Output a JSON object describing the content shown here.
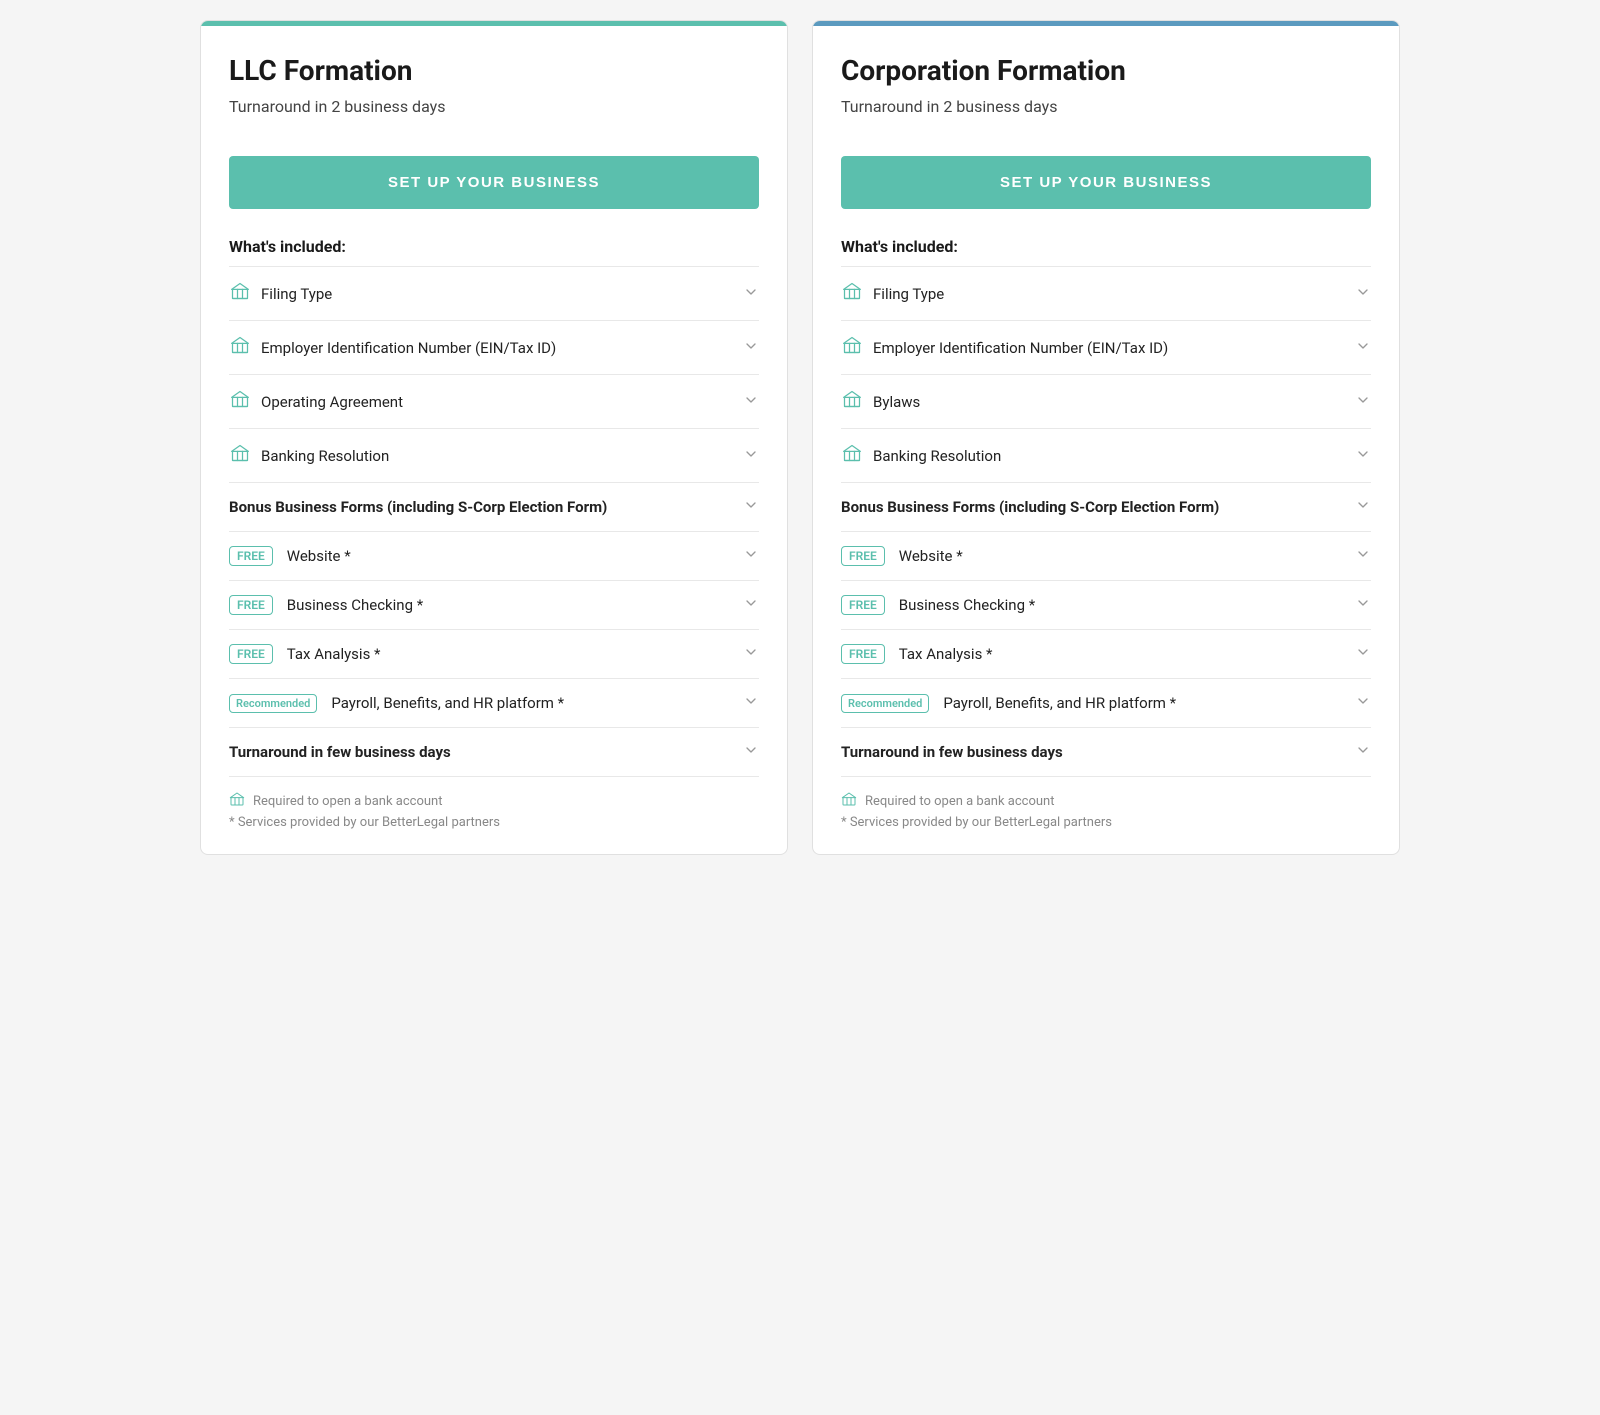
{
  "cards": [
    {
      "id": "llc",
      "colorClass": "card-llc",
      "title": "LLC Formation",
      "subtitle": "Turnaround in 2 business days",
      "button_label": "SET UP YOUR BUSINESS",
      "whats_included": "What's included:",
      "items": [
        {
          "type": "icon",
          "icon": "bank",
          "label": "Filing Type",
          "bold": false
        },
        {
          "type": "icon",
          "icon": "bank",
          "label": "Employer Identification Number (EIN/Tax ID)",
          "bold": false
        },
        {
          "type": "icon",
          "icon": "bank",
          "label": "Operating Agreement",
          "bold": false
        },
        {
          "type": "icon",
          "icon": "bank",
          "label": "Banking Resolution",
          "bold": false
        },
        {
          "type": "plain",
          "label": "Bonus Business Forms (including S-Corp Election Form)",
          "bold": true
        },
        {
          "type": "badge",
          "badge": "FREE",
          "label": "Website *",
          "bold": false
        },
        {
          "type": "badge",
          "badge": "FREE",
          "label": "Business Checking *",
          "bold": false
        },
        {
          "type": "badge",
          "badge": "FREE",
          "label": "Tax Analysis *",
          "bold": false
        },
        {
          "type": "badge",
          "badge": "Recommended",
          "badge_class": "badge-recommended",
          "label": "Payroll, Benefits, and HR platform *",
          "bold": false
        },
        {
          "type": "plain",
          "label": "Turnaround in few business days",
          "bold": true
        }
      ],
      "footer_icon_note": "Required to open a bank account",
      "footer_star_note": "* Services provided by our BetterLegal partners"
    },
    {
      "id": "corp",
      "colorClass": "card-corp",
      "title": "Corporation Formation",
      "subtitle": "Turnaround in 2 business days",
      "button_label": "SET UP YOUR BUSINESS",
      "whats_included": "What's included:",
      "items": [
        {
          "type": "icon",
          "icon": "bank",
          "label": "Filing Type",
          "bold": false
        },
        {
          "type": "icon",
          "icon": "bank",
          "label": "Employer Identification Number (EIN/Tax ID)",
          "bold": false
        },
        {
          "type": "icon",
          "icon": "bank",
          "label": "Bylaws",
          "bold": false
        },
        {
          "type": "icon",
          "icon": "bank",
          "label": "Banking Resolution",
          "bold": false
        },
        {
          "type": "plain",
          "label": "Bonus Business Forms (including S-Corp Election Form)",
          "bold": true
        },
        {
          "type": "badge",
          "badge": "FREE",
          "label": "Website *",
          "bold": false
        },
        {
          "type": "badge",
          "badge": "FREE",
          "label": "Business Checking *",
          "bold": false
        },
        {
          "type": "badge",
          "badge": "FREE",
          "label": "Tax Analysis *",
          "bold": false
        },
        {
          "type": "badge",
          "badge": "Recommended",
          "badge_class": "badge-recommended",
          "label": "Payroll, Benefits, and HR platform *",
          "bold": false
        },
        {
          "type": "plain",
          "label": "Turnaround in few business days",
          "bold": true
        }
      ],
      "footer_icon_note": "Required to open a bank account",
      "footer_star_note": "* Services provided by our BetterLegal partners"
    }
  ]
}
